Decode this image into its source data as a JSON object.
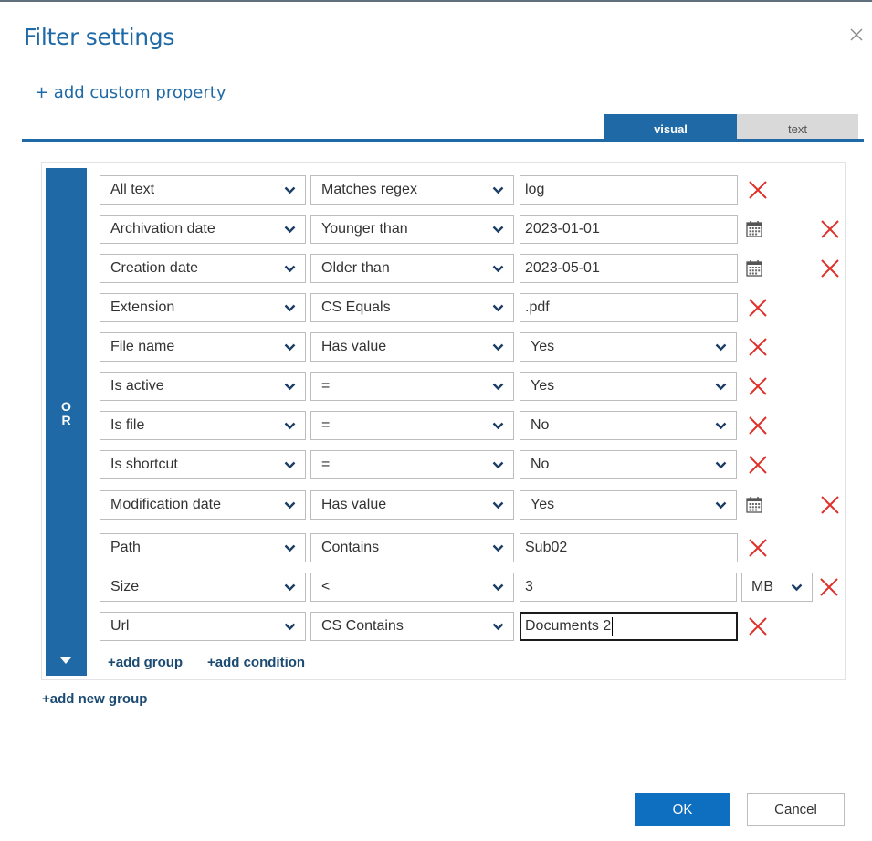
{
  "dialog": {
    "title": "Filter settings",
    "add_custom_property": "+ add custom property",
    "close_icon": "close-icon"
  },
  "tabs": [
    {
      "label": "visual",
      "active": true
    },
    {
      "label": "text",
      "active": false
    }
  ],
  "group": {
    "operator": "O\nR",
    "add_group": "+add group",
    "add_condition": "+add condition"
  },
  "conditions": [
    {
      "property": "All text",
      "operator": "Matches regex",
      "value": "log",
      "value_type": "text"
    },
    {
      "property": "Archivation date",
      "operator": "Younger than",
      "value": "2023-01-01",
      "value_type": "date"
    },
    {
      "property": "Creation date",
      "operator": "Older than",
      "value": "2023-05-01",
      "value_type": "date"
    },
    {
      "property": "Extension",
      "operator": "CS Equals",
      "value": ".pdf",
      "value_type": "text"
    },
    {
      "property": "File name",
      "operator": "Has value",
      "value": "Yes",
      "value_type": "select"
    },
    {
      "property": "Is active",
      "operator": "=",
      "value": "Yes",
      "value_type": "select"
    },
    {
      "property": "Is file",
      "operator": "=",
      "value": "No",
      "value_type": "select"
    },
    {
      "property": "Is shortcut",
      "operator": "=",
      "value": "No",
      "value_type": "select"
    },
    {
      "property": "Modification date",
      "operator": "Has value",
      "value": "Yes",
      "value_type": "select-date"
    },
    {
      "property": "Path",
      "operator": "Contains",
      "value": "Sub02",
      "value_type": "text"
    },
    {
      "property": "Size",
      "operator": "<",
      "value": "3",
      "value_type": "size",
      "unit": "MB"
    },
    {
      "property": "Url",
      "operator": "CS Contains",
      "value": "Documents 2",
      "value_type": "text",
      "focused": true
    }
  ],
  "add_new_group": "+add new group",
  "buttons": {
    "ok": "OK",
    "cancel": "Cancel"
  },
  "colors": {
    "accent": "#1f6aa6",
    "delete": "#e0302a",
    "ok_button": "#0e6fc0",
    "inactive_tab": "#d9d9d9"
  }
}
